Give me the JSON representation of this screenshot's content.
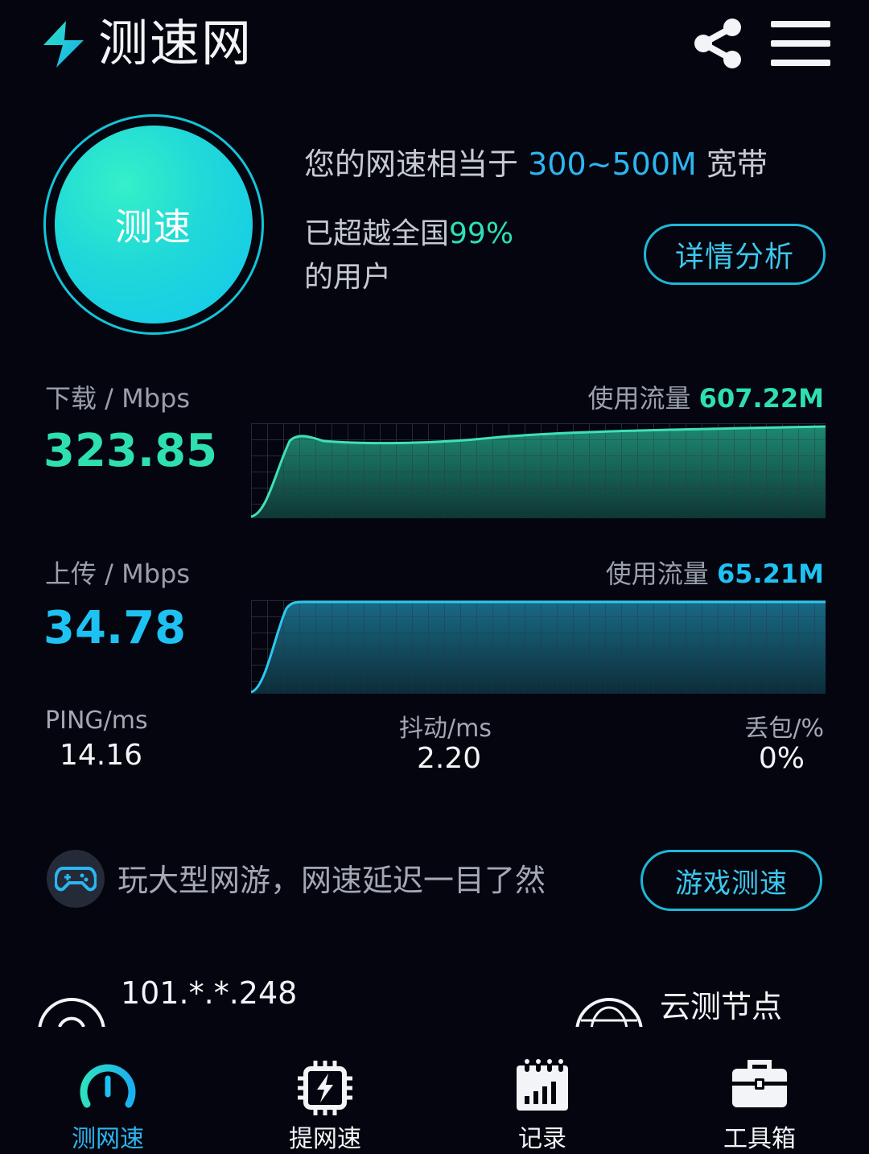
{
  "header": {
    "title": "测速网",
    "share_icon": "share-icon",
    "menu_icon": "menu-icon",
    "logo_icon": "lightning-logo-icon"
  },
  "test": {
    "button_label": "测速",
    "equivalent_prefix": "您的网速相当于 ",
    "equivalent_value": "300~500M",
    "equivalent_suffix": " 宽带",
    "rank_prefix": "已超越全国",
    "rank_value": "99%",
    "rank_suffix": "的用户",
    "detail_button": "详情分析"
  },
  "download": {
    "label": "下载 / Mbps",
    "value": "323.85",
    "traffic_label": "使用流量 ",
    "traffic_value": "607.22M",
    "color": "#2ee0b0"
  },
  "upload": {
    "label": "上传 / Mbps",
    "value": "34.78",
    "traffic_label": "使用流量 ",
    "traffic_value": "65.21M",
    "color": "#1ec2f2"
  },
  "stats": {
    "ping_label": "PING/ms",
    "ping_value": "14.16",
    "jitter_label": "抖动/ms",
    "jitter_value": "2.20",
    "loss_label": "丢包/%",
    "loss_value": "0%"
  },
  "game": {
    "icon": "gamepad-icon",
    "text": "玩大型网游，网速延迟一目了然",
    "button": "游戏测速"
  },
  "network": {
    "ip_value": "101.*.*.248",
    "node_label": "云测节点"
  },
  "nav": {
    "items": [
      {
        "label": "测网速",
        "icon": "speedometer-icon",
        "active": true
      },
      {
        "label": "提网速",
        "icon": "boost-chip-icon",
        "active": false
      },
      {
        "label": "记录",
        "icon": "calendar-chart-icon",
        "active": false
      },
      {
        "label": "工具箱",
        "icon": "toolbox-icon",
        "active": false
      }
    ]
  },
  "colors": {
    "accent_blue": "#2cb6f0",
    "accent_green": "#2ee0b0",
    "background": "#05050f"
  }
}
